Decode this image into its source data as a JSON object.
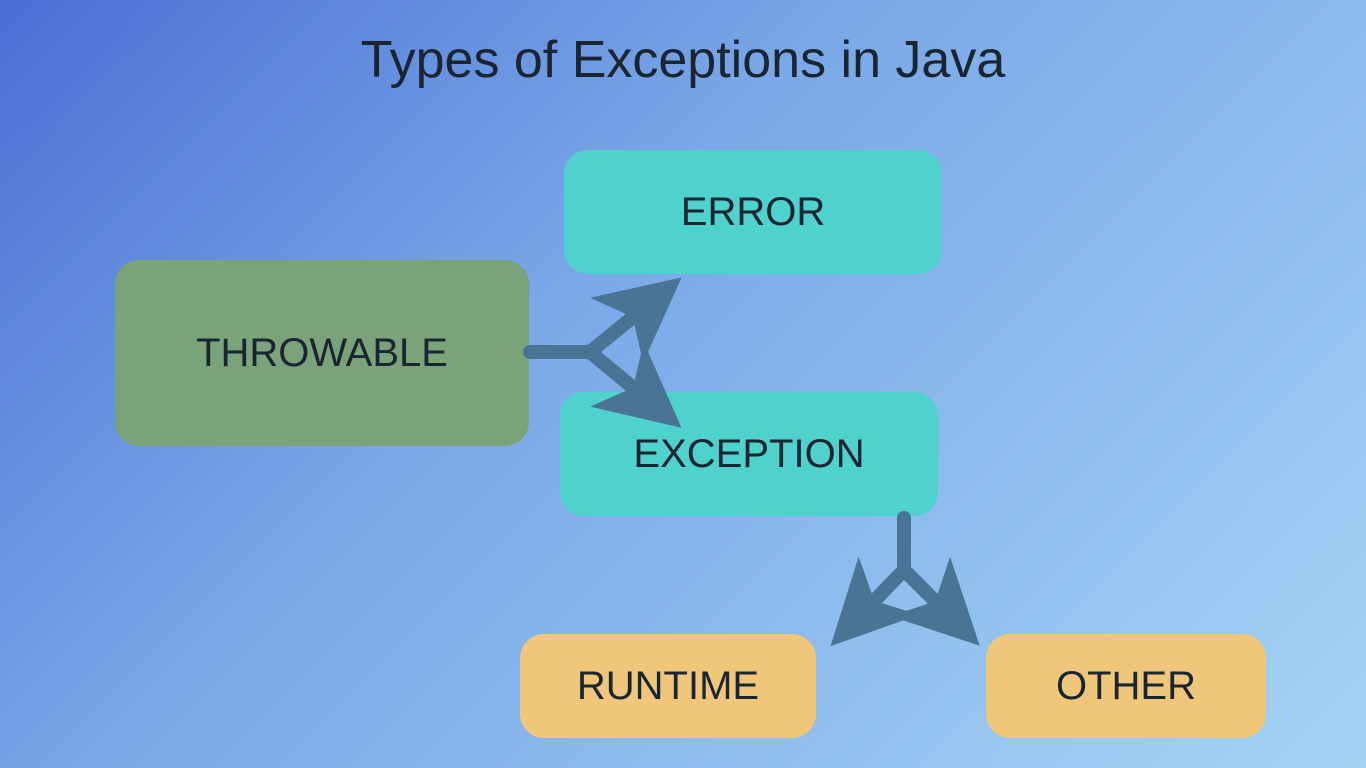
{
  "title": "Types of Exceptions in Java",
  "nodes": {
    "throwable": "THROWABLE",
    "error": "ERROR",
    "exception": "EXCEPTION",
    "runtime": "RUNTIME",
    "other": "OTHER"
  },
  "colors": {
    "throwable_bg": "#7ba37a",
    "teal_bg": "#4fd1ce",
    "tan_bg": "#f0c77a",
    "arrow": "#4a7494",
    "text": "#1a2532"
  }
}
